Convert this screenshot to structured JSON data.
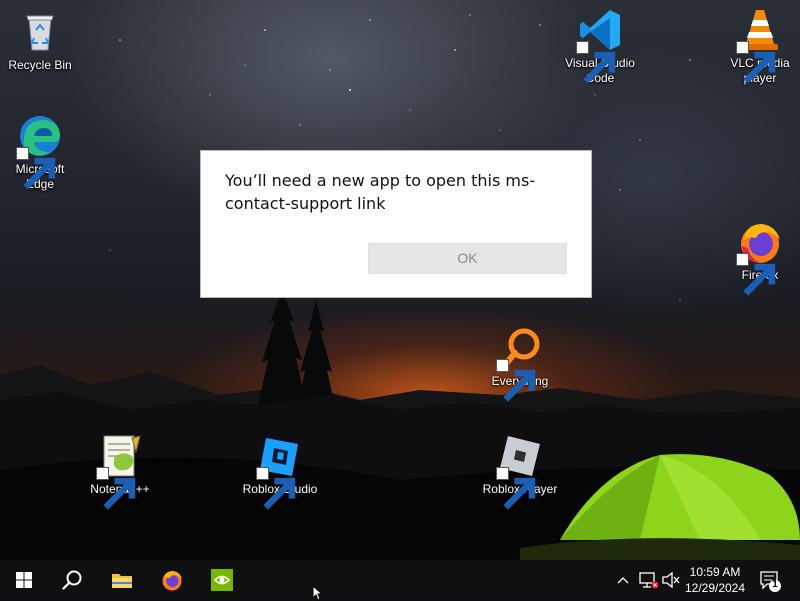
{
  "desktop": {
    "icons": [
      {
        "label": "Recycle Bin",
        "icon": "recycle-bin-icon"
      },
      {
        "label": "Microsoft Edge",
        "icon": "edge-icon"
      },
      {
        "label": "Visual Studio Code",
        "icon": "vscode-icon"
      },
      {
        "label": "VLC media player",
        "icon": "vlc-icon"
      },
      {
        "label": "Firefox",
        "icon": "firefox-icon"
      },
      {
        "label": "Everything",
        "icon": "everything-icon"
      },
      {
        "label": "Notepad++",
        "icon": "notepadpp-icon"
      },
      {
        "label": "Roblox Studio",
        "icon": "roblox-studio-icon"
      },
      {
        "label": "Roblox Player",
        "icon": "roblox-player-icon"
      }
    ]
  },
  "dialog": {
    "message": "You’ll need a new app to open this ms-contact-support link",
    "ok_label": "OK"
  },
  "taskbar": {
    "buttons": [
      {
        "name": "start",
        "icon": "windows-logo-icon"
      },
      {
        "name": "search",
        "icon": "search-icon"
      },
      {
        "name": "file-explorer",
        "icon": "folder-icon"
      },
      {
        "name": "firefox",
        "icon": "firefox-icon"
      },
      {
        "name": "nvidia",
        "icon": "nvidia-icon"
      }
    ],
    "tray": {
      "time": "10:59 AM",
      "date": "12/29/2024",
      "notification_count": "1"
    }
  },
  "colors": {
    "taskbar": "#101010",
    "dialog_bg": "#ffffff",
    "button_bg": "#e6e6e6",
    "tent_green": "#8fd41c"
  }
}
